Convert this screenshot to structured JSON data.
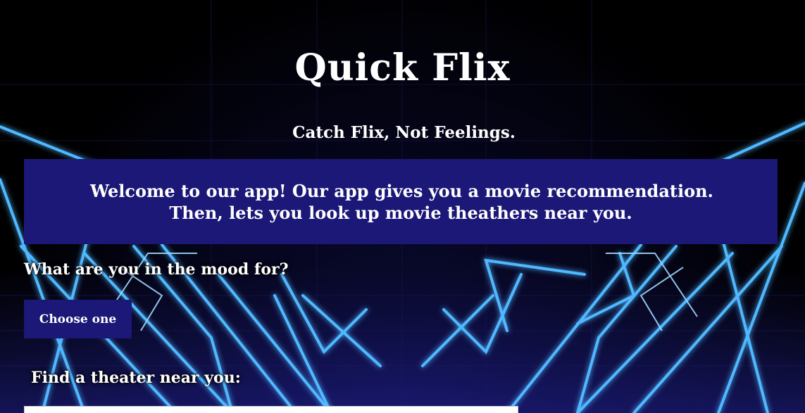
{
  "header": {
    "title": "Quick Flix",
    "tagline": "Catch Flix, Not Feelings."
  },
  "welcome": {
    "line1": "Welcome to our app! Our app gives you a movie recommendation.",
    "line2": "Then, lets you look up movie theathers near you."
  },
  "mood": {
    "label": "What are you in the mood for?",
    "button_label": "Choose one"
  },
  "theater": {
    "label": "Find a theater near you:",
    "input_value": "",
    "input_placeholder": ""
  },
  "colors": {
    "panel": "#1b1877",
    "neon_blue": "#4fb8ff",
    "background": "#000000"
  }
}
